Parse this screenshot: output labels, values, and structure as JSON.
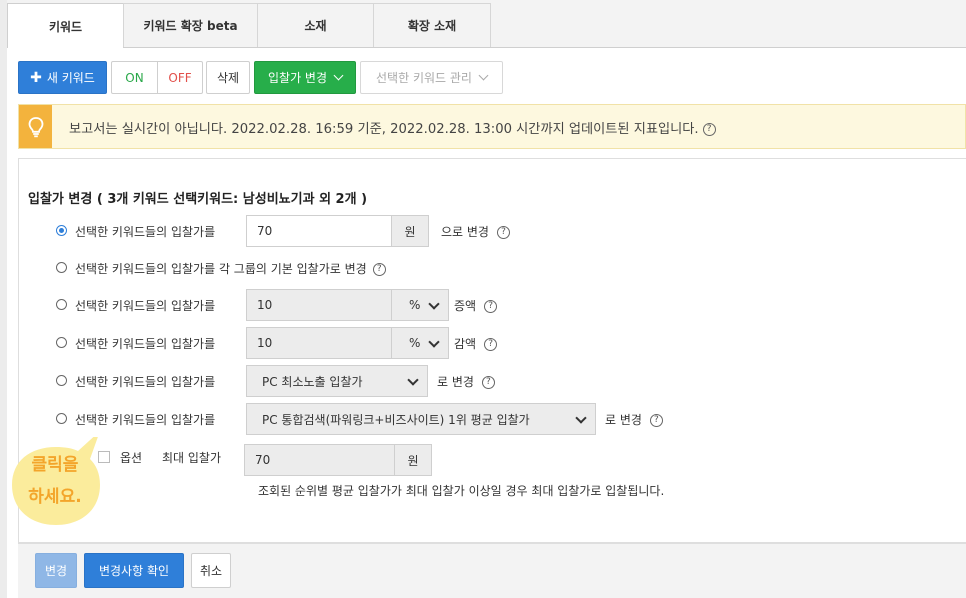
{
  "tabs": [
    {
      "label": "키워드",
      "active": true
    },
    {
      "label": "키워드 확장 beta",
      "active": false
    },
    {
      "label": "소재",
      "active": false
    },
    {
      "label": "확장 소재",
      "active": false
    }
  ],
  "toolbar": {
    "new_keyword": "새 키워드",
    "new_keyword_icon": "plus-icon",
    "on": "ON",
    "off": "OFF",
    "delete": "삭제",
    "bid_change": "입찰가 변경",
    "manage": "선택한 키워드 관리"
  },
  "notice": {
    "icon": "lightbulb-icon",
    "text": "보고서는 실시간이 아닙니다. 2022.02.28. 16:59 기준, 2022.02.28. 13:00 시간까지 업데이트된 지표입니다.",
    "help": "?"
  },
  "form": {
    "title": "입찰가 변경 ( 3개 키워드 선택키워드: 남성비뇨기과 외 2개 )",
    "label_prefix": "선택한 키워드들의 입찰가를",
    "rows": [
      {
        "checked": true,
        "value": "70",
        "unit": "원",
        "suffix": "으로 변경"
      },
      {
        "checked": false,
        "suffix": "각 그룹의 기본 입찰가로 변경"
      },
      {
        "checked": false,
        "value": "10",
        "unit": "%",
        "suffix": "증액"
      },
      {
        "checked": false,
        "value": "10",
        "unit": "%",
        "suffix": "감액"
      },
      {
        "checked": false,
        "select": "PC 최소노출 입찰가",
        "suffix": "로 변경"
      },
      {
        "checked": false,
        "select": "PC 통합검색(파워링크+비즈사이트) 1위 평균 입찰가",
        "suffix": "로 변경"
      }
    ],
    "option": {
      "label": "옵션",
      "max_bid_label": "최대 입찰가",
      "max_bid_value": "70",
      "max_bid_unit": "원",
      "note": "조회된 순위별 평균 입찰가가 최대 입찰가 이상일 경우 최대 입찰가로 입찰됩니다."
    }
  },
  "footer": {
    "change": "변경",
    "confirm": "변경사항 확인",
    "cancel": "취소"
  },
  "callout": {
    "line1": "클릭을",
    "line2": "하세요."
  },
  "colors": {
    "primary": "#2f7fd9",
    "green": "#27ae4a",
    "notice_bg": "#fdf8df",
    "notice_icon_bg": "#f3b33d",
    "callout_bg": "#fbec9c",
    "callout_text": "#f3a52b"
  }
}
